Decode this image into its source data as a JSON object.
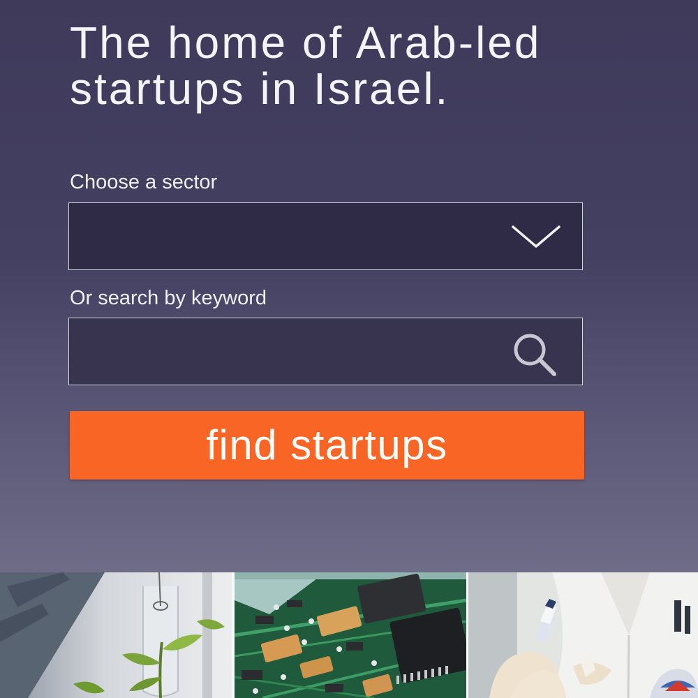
{
  "hero": {
    "headline": "The home of Arab-led startups in Israel.",
    "background_top": "#3f3a5a",
    "background_bottom": "#6f6c88"
  },
  "sector_select": {
    "label": "Choose a sector",
    "selected_value": "",
    "icon": "chevron-down-icon"
  },
  "keyword_search": {
    "label": "Or search by keyword",
    "value": "",
    "placeholder": "",
    "icon": "search-icon"
  },
  "find_button": {
    "label": "find startups",
    "color": "#f86524"
  },
  "photos": [
    {
      "subject": "plant-in-test-tube"
    },
    {
      "subject": "circuit-board"
    },
    {
      "subject": "lab-scientist"
    }
  ]
}
